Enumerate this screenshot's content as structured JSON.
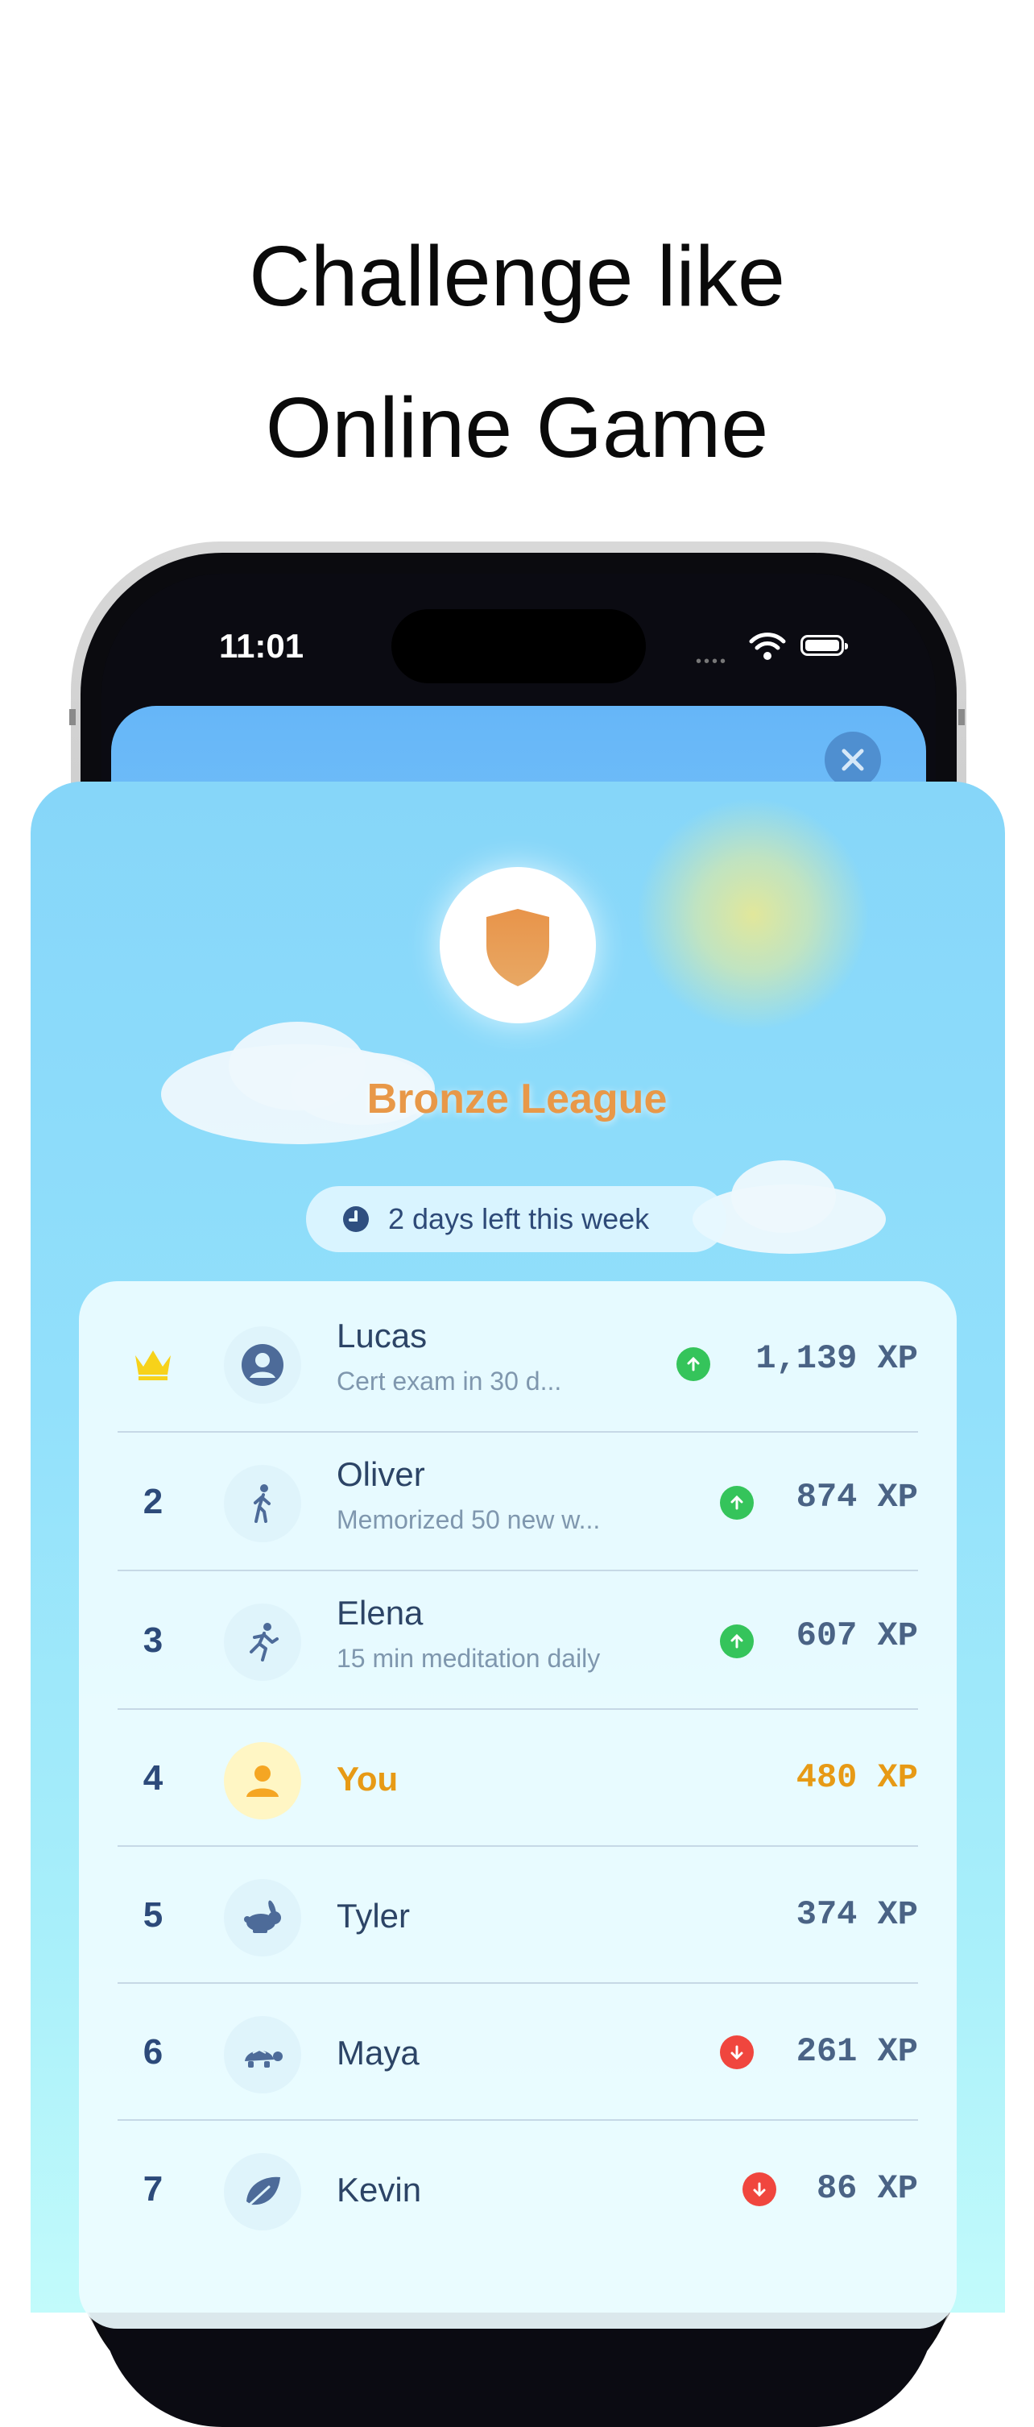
{
  "headline": {
    "line1": "Challenge like",
    "line2": "Online Game"
  },
  "status_bar": {
    "time": "11:01"
  },
  "league": {
    "title": "Bronze League",
    "badge_icon": "shield-icon",
    "timer": "2 days left this week"
  },
  "colors": {
    "league_accent": "#e89848",
    "self_accent": "#e79a15",
    "up": "#35c45b",
    "down": "#f0463e"
  },
  "leaderboard": [
    {
      "rank": "",
      "rank_icon": "crown-icon",
      "name": "Lucas",
      "subtitle": "Cert exam in 30 d...",
      "trend": "up",
      "xp": "1,139 XP",
      "avatar_icon": "user-circle-icon"
    },
    {
      "rank": "2",
      "name": "Oliver",
      "subtitle": "Memorized 50 new w...",
      "trend": "up",
      "xp": "874 XP",
      "avatar_icon": "walking-icon"
    },
    {
      "rank": "3",
      "name": "Elena",
      "subtitle": "15 min meditation daily",
      "trend": "up",
      "xp": "607 XP",
      "avatar_icon": "running-icon"
    },
    {
      "rank": "4",
      "name": "You",
      "subtitle": "",
      "trend": "",
      "xp": "480 XP",
      "avatar_icon": "person-icon"
    },
    {
      "rank": "5",
      "name": "Tyler",
      "subtitle": "",
      "trend": "",
      "xp": "374 XP",
      "avatar_icon": "rabbit-icon"
    },
    {
      "rank": "6",
      "name": "Maya",
      "subtitle": "",
      "trend": "down",
      "xp": "261 XP",
      "avatar_icon": "turtle-icon"
    },
    {
      "rank": "7",
      "name": "Kevin",
      "subtitle": "",
      "trend": "down",
      "xp": "86 XP",
      "avatar_icon": "leaf-icon"
    }
  ]
}
